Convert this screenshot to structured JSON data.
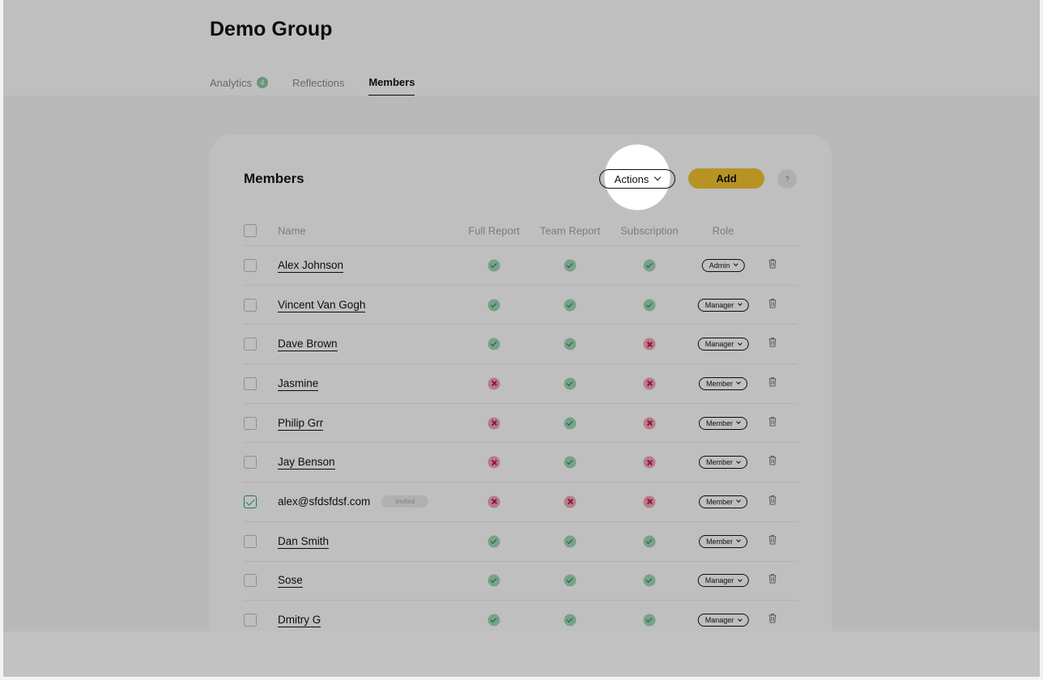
{
  "header": {
    "title": "Demo Group",
    "tabs": [
      {
        "label": "Analytics",
        "badge": "4",
        "active": false
      },
      {
        "label": "Reflections",
        "active": false
      },
      {
        "label": "Members",
        "active": true
      }
    ]
  },
  "card": {
    "title": "Members",
    "actions_label": "Actions",
    "add_label": "Add",
    "help_label": "?"
  },
  "table": {
    "columns": {
      "name": "Name",
      "full_report": "Full Report",
      "team_report": "Team Report",
      "subscription": "Subscription",
      "role": "Role"
    },
    "rows": [
      {
        "name": "Alex Johnson",
        "full": true,
        "team": true,
        "sub": true,
        "role": "Admin",
        "checked": false
      },
      {
        "name": "Vincent Van Gogh",
        "full": true,
        "team": true,
        "sub": true,
        "role": "Manager",
        "checked": false
      },
      {
        "name": "Dave Brown",
        "full": true,
        "team": true,
        "sub": false,
        "role": "Manager",
        "checked": false
      },
      {
        "name": "Jasmine",
        "full": false,
        "team": true,
        "sub": false,
        "role": "Member",
        "checked": false
      },
      {
        "name": "Philip Grr",
        "full": false,
        "team": true,
        "sub": false,
        "role": "Member",
        "checked": false
      },
      {
        "name": "Jay Benson",
        "full": false,
        "team": true,
        "sub": false,
        "role": "Member",
        "checked": false
      },
      {
        "name": "alex@sfdsfdsf.com",
        "invited": "Invited",
        "full": false,
        "team": false,
        "sub": false,
        "role": "Member",
        "checked": true
      },
      {
        "name": "Dan Smith",
        "full": true,
        "team": true,
        "sub": true,
        "role": "Member",
        "checked": false
      },
      {
        "name": "Sose",
        "full": true,
        "team": true,
        "sub": true,
        "role": "Manager",
        "checked": false
      },
      {
        "name": "Dmitry G",
        "full": true,
        "team": true,
        "sub": true,
        "role": "Manager",
        "checked": false
      }
    ]
  },
  "colors": {
    "accent": "#f4c430",
    "yes": "#9fd8b6",
    "no": "#f4a5b6",
    "checked": "#2ea36a"
  },
  "icons": {
    "trash": "trash-icon",
    "chevron": "chevron-down-icon",
    "check": "check-icon",
    "cross": "cross-icon"
  }
}
